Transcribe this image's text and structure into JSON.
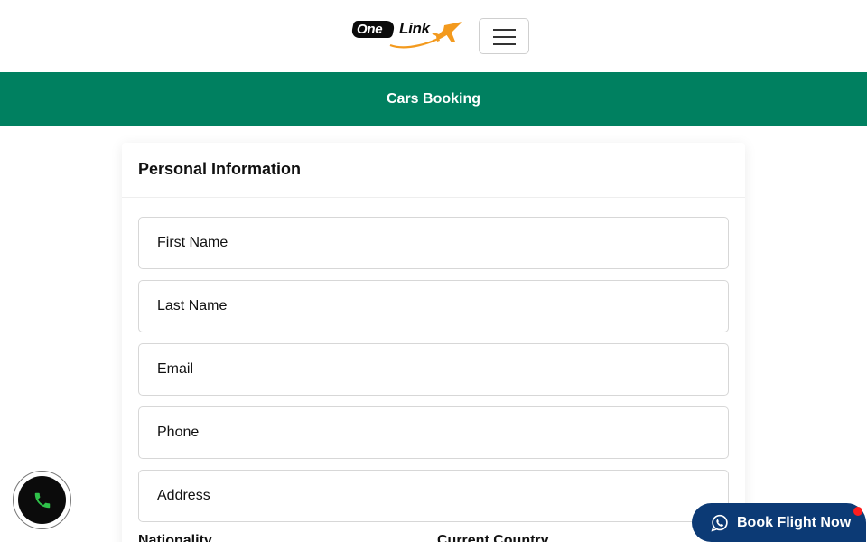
{
  "header": {
    "logo": {
      "word1": "One",
      "word2": "Link"
    },
    "menu_icon": "hamburger-icon"
  },
  "banner": {
    "title": "Cars Booking"
  },
  "form": {
    "title": "Personal Information",
    "fields": {
      "first_name": {
        "placeholder": "First Name",
        "value": ""
      },
      "last_name": {
        "placeholder": "Last Name",
        "value": ""
      },
      "email": {
        "placeholder": "Email",
        "value": ""
      },
      "phone": {
        "placeholder": "Phone",
        "value": ""
      },
      "address": {
        "placeholder": "Address",
        "value": ""
      }
    },
    "subheads": {
      "left": "Nationality",
      "right": "Current Country"
    }
  },
  "floating": {
    "call_icon": "phone-icon",
    "book_label": "Book Flight Now",
    "book_icon": "whatsapp-icon"
  },
  "colors": {
    "banner": "#008060",
    "book_button": "#0c3a75",
    "logo_accent": "#f39a1e",
    "notification": "#ff1e1e",
    "call_icon": "#2fc14a"
  }
}
